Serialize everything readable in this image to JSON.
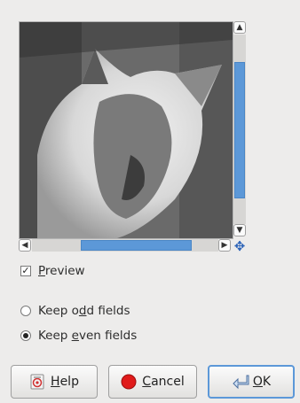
{
  "preview": {
    "checkbox_label": "Preview",
    "mnemonic": "P",
    "rest": "review",
    "checked": true
  },
  "options": [
    {
      "before": "Keep o",
      "mnemonic": "d",
      "after": "d fields",
      "selected": false
    },
    {
      "before": "Keep ",
      "mnemonic": "e",
      "after": "ven fields",
      "selected": true
    }
  ],
  "buttons": {
    "help": {
      "mnemonic": "H",
      "rest": "elp"
    },
    "cancel": {
      "mnemonic": "C",
      "rest": "ancel"
    },
    "ok": {
      "mnemonic": "O",
      "rest": "K"
    }
  },
  "icons": {
    "scroll_up": "chevron-up-icon",
    "scroll_down": "chevron-down-icon",
    "scroll_left": "chevron-left-icon",
    "scroll_right": "chevron-right-icon",
    "navigate": "move-icon",
    "help": "help-icon",
    "cancel": "cancel-icon",
    "ok": "ok-icon"
  },
  "colors": {
    "accent": "#5c98d8",
    "cancel_red": "#e01b1b"
  }
}
